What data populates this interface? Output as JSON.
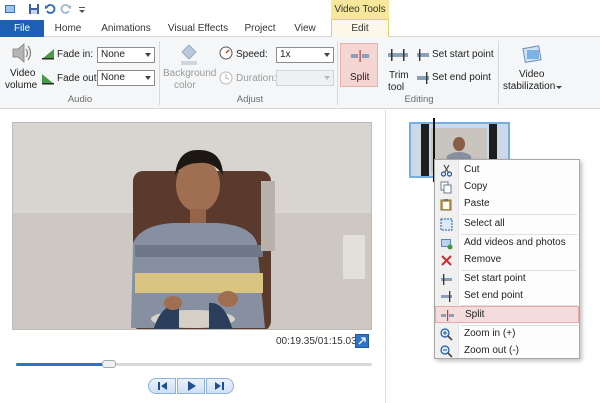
{
  "title_bar": {
    "contextual_tab_group": "Video Tools"
  },
  "tabs": [
    "File",
    "Home",
    "Animations",
    "Visual Effects",
    "Project",
    "View",
    "Edit"
  ],
  "ribbon": {
    "audio": {
      "video_volume_label": [
        "Video",
        "volume"
      ],
      "fade_in_label": "Fade in:",
      "fade_in_value": "None",
      "fade_out_label": "Fade out:",
      "fade_out_value": "None",
      "group_label": "Audio"
    },
    "adjust": {
      "background_color_label": [
        "Background",
        "color"
      ],
      "speed_label": "Speed:",
      "speed_value": "1x",
      "duration_label": "Duration:",
      "duration_value": "",
      "group_label": "Adjust"
    },
    "editing": {
      "split_label": "Split",
      "trim_tool_label": [
        "Trim",
        "tool"
      ],
      "set_start_point_label": "Set start point",
      "set_end_point_label": "Set end point",
      "group_label": "Editing"
    },
    "stabilization": {
      "label": [
        "Video",
        "stabilization"
      ]
    }
  },
  "preview": {
    "timecode": "00:19.35/01:15.03",
    "progress": 0.26
  },
  "context_menu": {
    "items": [
      {
        "label": "Cut",
        "icon": "scissors-icon"
      },
      {
        "label": "Copy",
        "icon": "copy-icon"
      },
      {
        "label": "Paste",
        "icon": "paste-icon"
      },
      {
        "label": "Select all",
        "icon": "select-all-icon"
      },
      {
        "label": "Add videos and photos",
        "icon": "add-media-icon"
      },
      {
        "label": "Remove",
        "icon": "remove-icon"
      },
      {
        "label": "Set start point",
        "icon": "set-start-icon"
      },
      {
        "label": "Set end point",
        "icon": "set-end-icon"
      },
      {
        "label": "Split",
        "icon": "split-icon",
        "highlighted": true
      },
      {
        "label": "Zoom in (+)",
        "icon": "zoom-in-icon"
      },
      {
        "label": "Zoom out (-)",
        "icon": "zoom-out-icon"
      }
    ]
  },
  "colors": {
    "file_tab": "#1c5fb5",
    "accent": "#2f73c9",
    "video_tools_bg": "#f6e79a",
    "split_highlight": "#f5d5d1",
    "selected_clip_border": "#74aee3"
  }
}
